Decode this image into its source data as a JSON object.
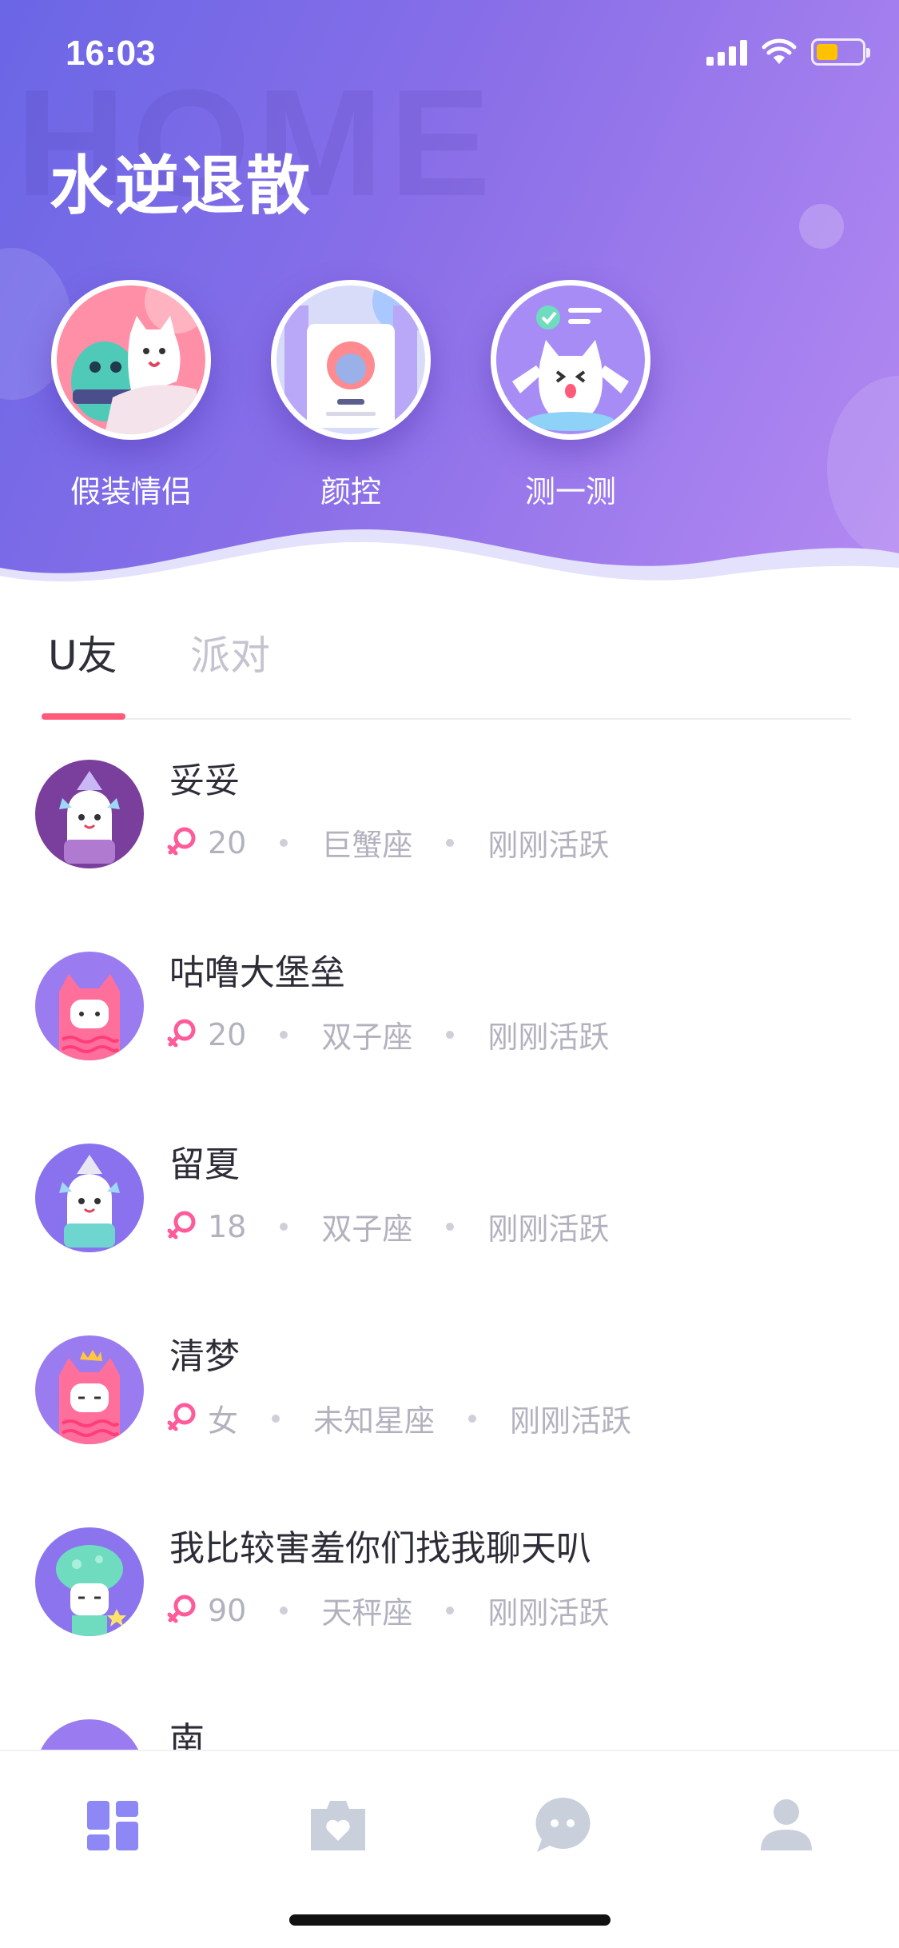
{
  "status_bar": {
    "time": "16:03"
  },
  "header": {
    "watermark": "HOME",
    "title": "水逆退散",
    "features": [
      {
        "label": "假装情侣"
      },
      {
        "label": "颜控"
      },
      {
        "label": "测一测"
      }
    ]
  },
  "tabs": [
    {
      "label": "U友",
      "active": true
    },
    {
      "label": "派对",
      "active": false
    }
  ],
  "users": [
    {
      "name": "妥妥",
      "age": "20",
      "zodiac": "巨蟹座",
      "status": "刚刚活跃"
    },
    {
      "name": "咕噜大堡垒",
      "age": "20",
      "zodiac": "双子座",
      "status": "刚刚活跃"
    },
    {
      "name": "留夏",
      "age": "18",
      "zodiac": "双子座",
      "status": "刚刚活跃"
    },
    {
      "name": "清梦",
      "age": "女",
      "zodiac": "未知星座",
      "status": "刚刚活跃"
    },
    {
      "name": "我比较害羞你们找我聊天叭",
      "age": "90",
      "zodiac": "天秤座",
      "status": "刚刚活跃"
    },
    {
      "name": "南",
      "age": "",
      "zodiac": "",
      "status": ""
    }
  ],
  "bottom_nav": [
    {
      "icon": "dashboard-icon",
      "active": true
    },
    {
      "icon": "photo-heart-icon",
      "active": false
    },
    {
      "icon": "chat-bubble-icon",
      "active": false
    },
    {
      "icon": "profile-icon",
      "active": false
    }
  ],
  "colors": {
    "accent": "#ff5a7a",
    "header_start": "#6a66e6",
    "header_end": "#b58af2",
    "nav_active": "#8d88f5",
    "nav_inactive": "#c9cfdb"
  }
}
